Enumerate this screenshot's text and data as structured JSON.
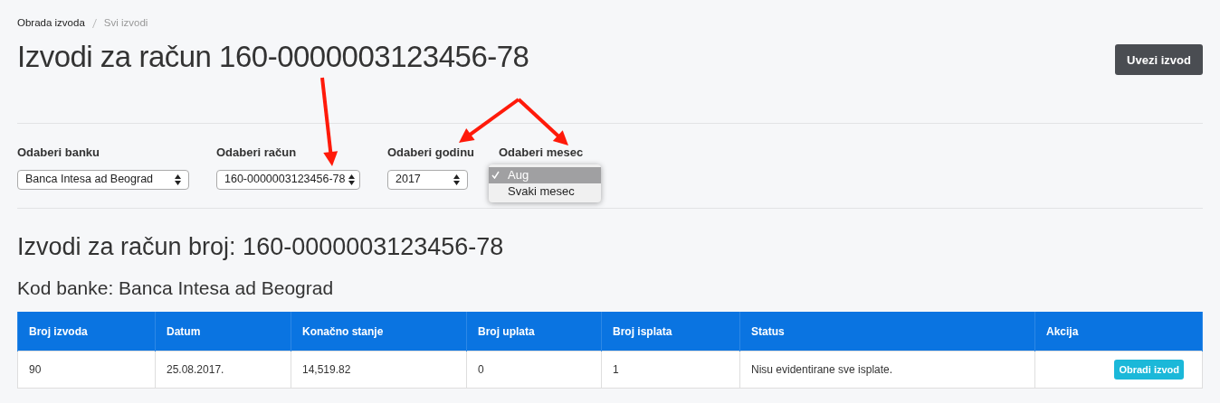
{
  "breadcrumb": [
    {
      "label": "Obrada izvoda",
      "current": false
    },
    {
      "label": "Svi izvodi",
      "current": true
    }
  ],
  "title": "Izvodi za račun 160-0000003123456-78",
  "primary_button": "Uvezi izvod",
  "filters": [
    {
      "label": "Odaberi banku",
      "kind": "select",
      "value": "Banca Intesa ad Beograd"
    },
    {
      "label": "Odaberi račun",
      "kind": "select",
      "value": "160-0000003123456-78"
    },
    {
      "label": "Odaberi godinu",
      "kind": "select",
      "value": "2017"
    },
    {
      "label": "Odaberi mesec",
      "kind": "menu",
      "options": [
        {
          "label": "Aug",
          "selected": true
        },
        {
          "label": "Svaki mesec",
          "selected": false
        }
      ]
    }
  ],
  "results_heading": "Izvodi za račun broj: 160-0000003123456-78",
  "bank_heading": "Kod banke: Banca Intesa ad Beograd",
  "table": {
    "columns": [
      "Broj izvoda",
      "Datum",
      "Konačno stanje",
      "Broj uplata",
      "Broj isplata",
      "Status",
      "Akcija"
    ],
    "rows": [
      {
        "cells": [
          "90",
          "25.08.2017.",
          "14,519.82",
          "0",
          "1",
          "Nisu evidentirane sve isplate."
        ],
        "action": "Obradi izvod"
      }
    ]
  }
}
